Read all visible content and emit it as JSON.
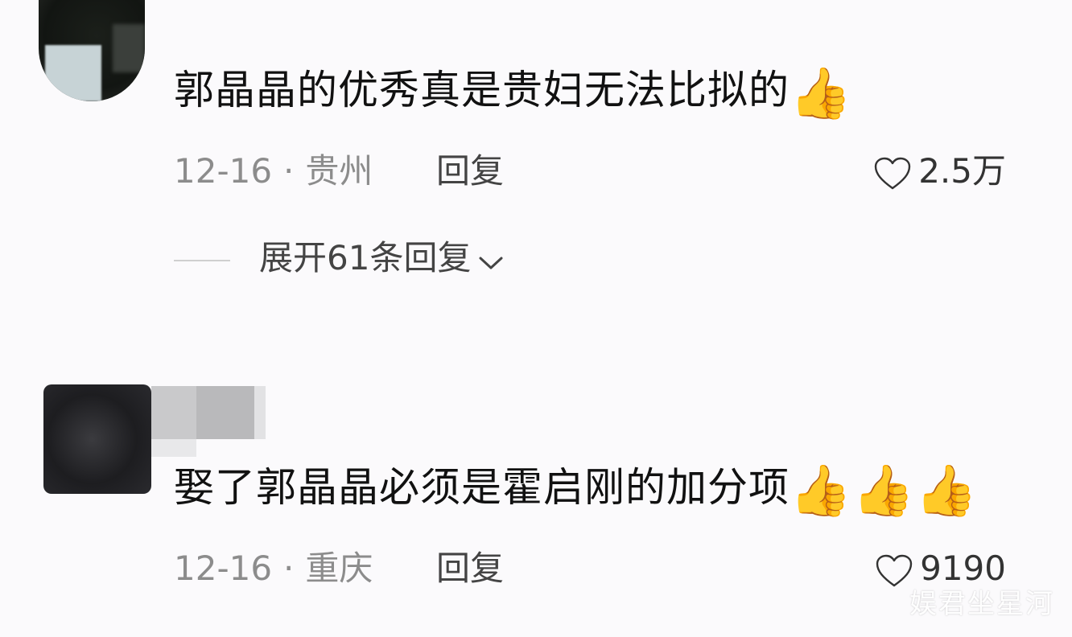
{
  "comments": [
    {
      "text": "郭晶晶的优秀真是贵妇无法比拟的",
      "emojis": [
        "👍"
      ],
      "date": "12-16",
      "separator": "·",
      "location": "贵州",
      "reply_label": "回复",
      "likes": "2.5万",
      "expand_label": "展开61条回复"
    },
    {
      "text": "娶了郭晶晶必须是霍启刚的加分项",
      "emojis": [
        "👍",
        "👍",
        "👍"
      ],
      "date": "12-16",
      "separator": "·",
      "location": "重庆",
      "reply_label": "回复",
      "likes": "9190"
    }
  ],
  "watermark": "娱君坐星河",
  "icons": {
    "like": "heart-outline-icon",
    "expand": "chevron-down-icon",
    "reaction": "thumbs-up-emoji"
  }
}
